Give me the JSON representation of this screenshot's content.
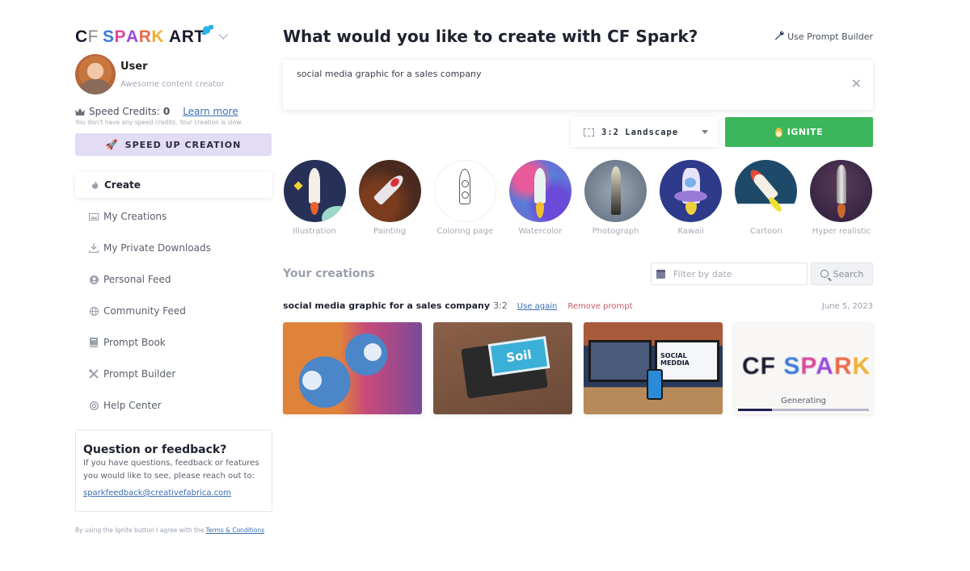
{
  "brand": {
    "logo_cf": "C",
    "logo_cf_dash": "F",
    "logo_spark_letters": [
      "S",
      "P",
      "A",
      "R",
      "K"
    ],
    "logo_art": "ART",
    "colors": {
      "primary_green": "#3cb65a",
      "speed_button_bg": "#e3dcf5",
      "link_blue": "#3a6fb0",
      "remove_red": "#c25a6a",
      "progress_fill": "#1e1e50"
    }
  },
  "user": {
    "name": "User",
    "role": "Awesome content creator"
  },
  "credits": {
    "label": "Speed Credits:",
    "value": "0",
    "learn_more": "Learn more",
    "note": "You don't have any speed credits. Your creation is slow."
  },
  "speed_button": {
    "label": "SPEED UP CREATION",
    "icon": "rocket-icon"
  },
  "nav": {
    "items": [
      {
        "label": "Create",
        "icon": "flame-icon",
        "active": true
      },
      {
        "label": "My Creations",
        "icon": "gallery-icon",
        "active": false
      },
      {
        "label": "My Private Downloads",
        "icon": "download-icon",
        "active": false
      },
      {
        "label": "Personal Feed",
        "icon": "user-circle-icon",
        "active": false
      },
      {
        "label": "Community Feed",
        "icon": "globe-icon",
        "active": false
      },
      {
        "label": "Prompt Book",
        "icon": "book-icon",
        "active": false
      },
      {
        "label": "Prompt Builder",
        "icon": "tools-icon",
        "active": false
      },
      {
        "label": "Help Center",
        "icon": "lifebuoy-icon",
        "active": false
      }
    ]
  },
  "feedback": {
    "title": "Question or feedback?",
    "text": "If you have questions, feedback or features you would like to see, please reach out to:",
    "email": "sparkfeedback@creativefabrica.com"
  },
  "terms": {
    "text": "By using the Ignite button I agree with the",
    "link": "Terms & Conditions"
  },
  "main": {
    "title": "What would you like to create with CF Spark?",
    "prompt_builder_link": "Use Prompt Builder",
    "prompt_value": "social media graphic for a sales company",
    "aspect_ratio": "3:2 Landscape",
    "ignite_label": "IGNITE"
  },
  "styles": [
    {
      "label": "Illustration"
    },
    {
      "label": "Painting"
    },
    {
      "label": "Coloring page"
    },
    {
      "label": "Watercolor"
    },
    {
      "label": "Photograph"
    },
    {
      "label": "Kawaii"
    },
    {
      "label": "Cartoon"
    },
    {
      "label": "Hyper realistic"
    }
  ],
  "creations": {
    "title": "Your creations",
    "filter_placeholder": "Filter by date",
    "search_label": "Search",
    "group": {
      "prompt": "social media graphic for a sales company",
      "ratio": "3:2",
      "use_again": "Use again",
      "remove": "Remove prompt",
      "date": "June 5, 2023",
      "images": [
        {
          "alt": "Social media icons collage"
        },
        {
          "alt": "Tablet with soil screen"
        },
        {
          "alt": "Monitors showing social media",
          "screen_text": "SOCIAL MEDDIA"
        },
        {
          "status": "Generating",
          "progress_percent": 26,
          "placeholder_text": "SPARK"
        }
      ]
    }
  }
}
